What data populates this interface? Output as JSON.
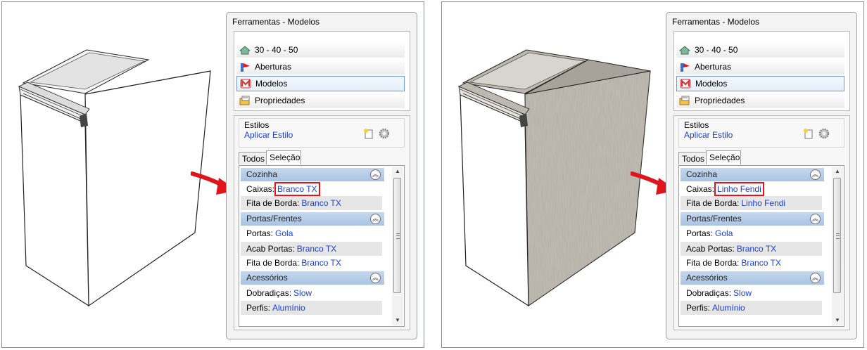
{
  "colors": {
    "accent_red": "#e0141d",
    "link_blue": "#1a3fd8",
    "group_header": "#b9cfe9",
    "row_alt": "#e6e6e6"
  },
  "panels": [
    {
      "title": "Ferramentas - Modelos",
      "nav": [
        {
          "icon": "house-icon",
          "label": "30 - 40 - 50"
        },
        {
          "icon": "door-opening-icon",
          "label": "Aberturas"
        },
        {
          "icon": "models-m-icon",
          "label": "Modelos",
          "selected": true
        },
        {
          "icon": "properties-icon",
          "label": "Propriedades"
        }
      ],
      "styles_label": "Estilos",
      "apply_link": "Aplicar Estilo",
      "tabs": [
        "Todos",
        "Seleção"
      ],
      "groups": [
        {
          "name": "Cozinha",
          "rows": [
            {
              "label": "Caixas:",
              "value": "Branco TX",
              "highlight": true
            },
            {
              "label": "Fita de Borda:",
              "value": "Branco TX"
            }
          ]
        },
        {
          "name": "Portas/Frentes",
          "rows": [
            {
              "label": "Portas:",
              "value": "Gola"
            },
            {
              "label": "Acab Portas:",
              "value": "Branco TX"
            },
            {
              "label": "Fita de Borda:",
              "value": "Branco TX"
            }
          ]
        },
        {
          "name": "Acessórios",
          "rows": [
            {
              "label": "Dobradiças:",
              "value": "Slow"
            },
            {
              "label": "Perfis:",
              "value": "Alumínio"
            }
          ]
        }
      ]
    },
    {
      "title": "Ferramentas - Modelos",
      "nav": [
        {
          "icon": "house-icon",
          "label": "30 - 40 - 50"
        },
        {
          "icon": "door-opening-icon",
          "label": "Aberturas"
        },
        {
          "icon": "models-m-icon",
          "label": "Modelos",
          "selected": true
        },
        {
          "icon": "properties-icon",
          "label": "Propriedades"
        }
      ],
      "styles_label": "Estilos",
      "apply_link": "Aplicar Estilo",
      "tabs": [
        "Todos",
        "Seleção"
      ],
      "groups": [
        {
          "name": "Cozinha",
          "rows": [
            {
              "label": "Caixas:",
              "value": "Linho Fendi",
              "highlight": true
            },
            {
              "label": "Fita de Borda:",
              "value": "Linho Fendi"
            }
          ]
        },
        {
          "name": "Portas/Frentes",
          "rows": [
            {
              "label": "Portas:",
              "value": "Gola"
            },
            {
              "label": "Acab Portas:",
              "value": "Branco TX"
            },
            {
              "label": "Fita de Borda:",
              "value": "Branco TX"
            }
          ]
        },
        {
          "name": "Acessórios",
          "rows": [
            {
              "label": "Dobradiças:",
              "value": "Slow"
            },
            {
              "label": "Perfis:",
              "value": "Alumínio"
            }
          ]
        }
      ]
    }
  ]
}
